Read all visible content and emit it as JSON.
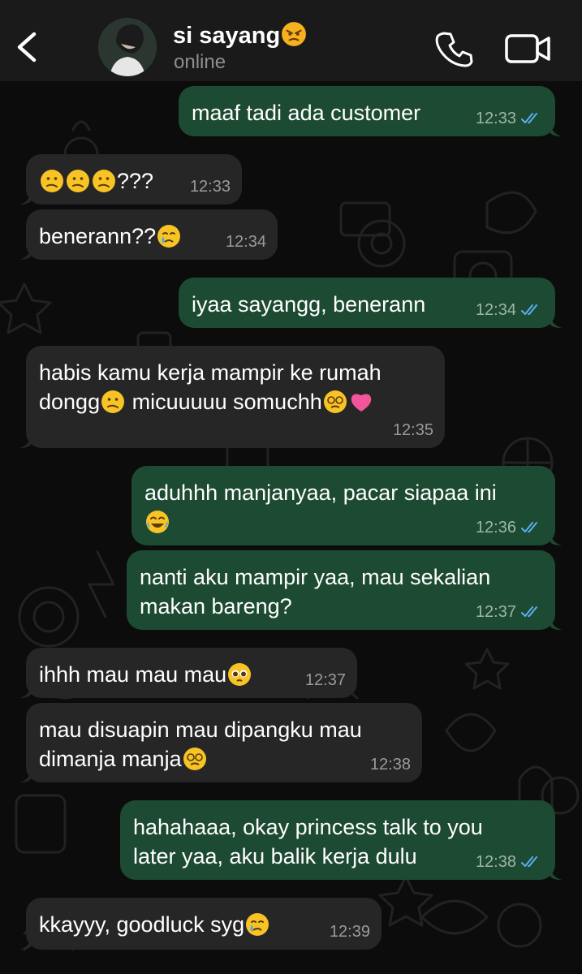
{
  "header": {
    "contact_name": "si sayang",
    "name_emoji": "angry-face",
    "status": "online"
  },
  "colors": {
    "header_bg": "#1a1a1a",
    "background": "#0c0c0c",
    "incoming_bubble": "#262626",
    "outgoing_bubble": "#1d4a32",
    "read_ticks": "#5aaef0",
    "meta_text": "#9a9a9a"
  },
  "messages": [
    {
      "from": "me",
      "text": "maaf tadi ada customer",
      "time": "12:33",
      "read": true
    },
    {
      "from": "them",
      "text": "???",
      "emojis_before": [
        "confused-face",
        "confused-face",
        "confused-face"
      ],
      "time": "12:33"
    },
    {
      "from": "them",
      "text": "benerann??",
      "emojis_after": [
        "crying-face"
      ],
      "time": "12:34"
    },
    {
      "from": "me",
      "text": "iyaa sayangg, benerann",
      "time": "12:34",
      "read": true
    },
    {
      "from": "them",
      "line1": "habis kamu kerja mampir ke rumah",
      "line2a": "dongg",
      "line2b": " micuuuuu somuchh",
      "emojis": [
        "confused-face",
        "dizzy-face",
        "pink-heart"
      ],
      "time": "12:35"
    },
    {
      "from": "me",
      "text": "aduhhh manjanyaa, pacar siapaa ini",
      "emojis": [
        "tears-of-joy-face"
      ],
      "time": "12:36",
      "read": true
    },
    {
      "from": "me",
      "line1": "nanti aku mampir yaa, mau sekalian",
      "line2": "makan bareng?",
      "time": "12:37",
      "read": true
    },
    {
      "from": "them",
      "text": "ihhh mau mau mau",
      "emojis_after": [
        "pleading-face"
      ],
      "time": "12:37"
    },
    {
      "from": "them",
      "line1": "mau disuapin mau dipangku mau",
      "line2": "dimanja manja",
      "emojis_after": [
        "dizzy-face"
      ],
      "time": "12:38"
    },
    {
      "from": "me",
      "line1": "hahahaaa, okay princess talk to you",
      "line2": "later yaa, aku balik kerja dulu",
      "time": "12:38",
      "read": true
    },
    {
      "from": "them",
      "text": "kkayyy, goodluck syg",
      "emojis_after": [
        "crying-face"
      ],
      "time": "12:39"
    }
  ]
}
